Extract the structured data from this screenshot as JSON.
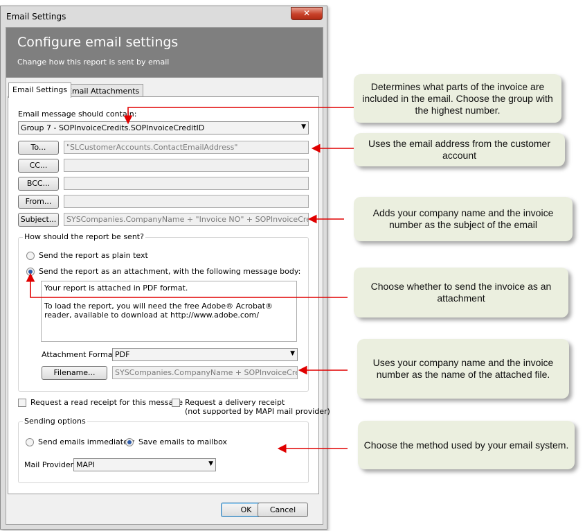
{
  "window": {
    "title": "Email Settings",
    "close_label": "✕"
  },
  "header": {
    "title": "Configure email settings",
    "subtitle": "Change how this report is sent by email"
  },
  "tabs": [
    {
      "label": "Email Settings"
    },
    {
      "label": "Email Attachments"
    }
  ],
  "contain": {
    "label": "Email message should contain:",
    "value": "Group 7 - SOPInvoiceCredits.SOPInvoiceCreditID"
  },
  "address": {
    "to_label": "To...",
    "to_value": "\"SLCustomerAccounts.ContactEmailAddress\"",
    "cc_label": "CC...",
    "bcc_label": "BCC...",
    "from_label": "From...",
    "subject_label": "Subject...",
    "subject_value": "SYSCompanies.CompanyName + \"Invoice NO\" + SOPInvoiceCredits.Doc"
  },
  "send_group": {
    "title": "How should the report be sent?",
    "plain_label": "Send the report as plain text",
    "attach_label": "Send the report as an attachment, with the following message body:",
    "body_line1": "Your report is attached in PDF format.",
    "body_line2": "To load the report, you will need the free Adobe® Acrobat® reader, available to download at http://www.adobe.com/",
    "format_label": "Attachment Format:",
    "format_value": "PDF",
    "filename_label": "Filename...",
    "filename_value": "SYSCompanies.CompanyName + SOPInvoiceCredits.Do"
  },
  "receipts": {
    "read_label": "Request a read receipt for this message",
    "delivery_label": "Request a delivery receipt",
    "delivery_note": "(not supported by MAPI mail provider)"
  },
  "sending": {
    "title": "Sending options",
    "immediately_label": "Send emails immediately",
    "mailbox_label": "Save emails to mailbox",
    "provider_label": "Mail Provider",
    "provider_value": "MAPI"
  },
  "footer": {
    "ok": "OK",
    "cancel": "Cancel"
  },
  "callouts": {
    "c1": "Determines what parts of the invoice are included in the email. Choose the group with the highest number.",
    "c2": "Uses the email address from the customer account",
    "c3": "Adds your company name and the invoice number as the subject of the email",
    "c4": "Choose whether to send the invoice as an attachment",
    "c5": "Uses your company name and the invoice number as the name of the attached file.",
    "c6": "Choose the method used by your email system."
  },
  "colors": {
    "header_bg": "#7f7f7f",
    "callout_bg": "#ebefdf",
    "arrow": "#e00000"
  }
}
